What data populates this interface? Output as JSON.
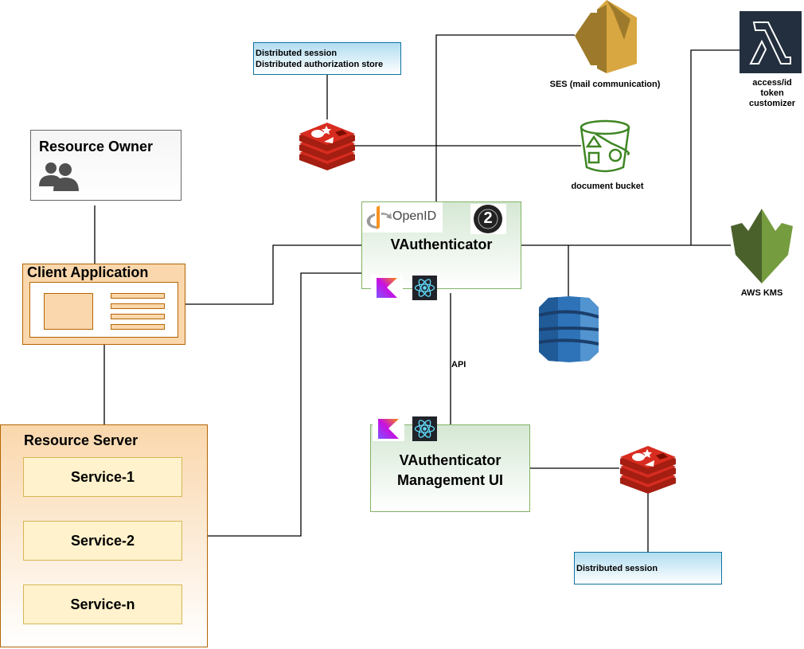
{
  "diagram": {
    "resource_owner": {
      "title": "Resource Owner",
      "icon": "users-icon"
    },
    "client_application": {
      "title": "Client Application",
      "icon": "browser-window-icon"
    },
    "resource_server": {
      "title": "Resource Server",
      "services": [
        "Service-1",
        "Service-2",
        "Service-n"
      ]
    },
    "vauthenticator": {
      "title": "VAuthenticator",
      "logos": {
        "openid": "OpenID",
        "oauth2": "2"
      },
      "tech_icons": [
        "kotlin-icon",
        "react-icon"
      ]
    },
    "management_ui": {
      "title_line1": "VAuthenticator",
      "title_line2": "Management UI",
      "tech_icons": [
        "kotlin-icon",
        "react-icon"
      ]
    },
    "api_label": "API",
    "redis_top_note": {
      "line1": "Distributed session",
      "line2": "Distributed authorization store"
    },
    "redis_bottom_note": {
      "line1": "Distributed session"
    },
    "ses": {
      "label": "SES (mail communication)"
    },
    "s3": {
      "label": "document bucket"
    },
    "lambda": {
      "line1": "access/id",
      "line2": "token",
      "line3": "customizer"
    },
    "kms": {
      "label": "AWS KMS"
    },
    "dynamodb": {
      "icon": "dynamodb-icon"
    }
  },
  "colors": {
    "redis": "#c6302b",
    "ses": "#d9a741",
    "s3": "#3f8624",
    "lambda_bg": "#232f3e",
    "kms": "#759c3e",
    "dynamodb": "#2e73b8",
    "note_border": "#10739e",
    "green_border": "#82b366",
    "orange_border": "#b46504"
  }
}
